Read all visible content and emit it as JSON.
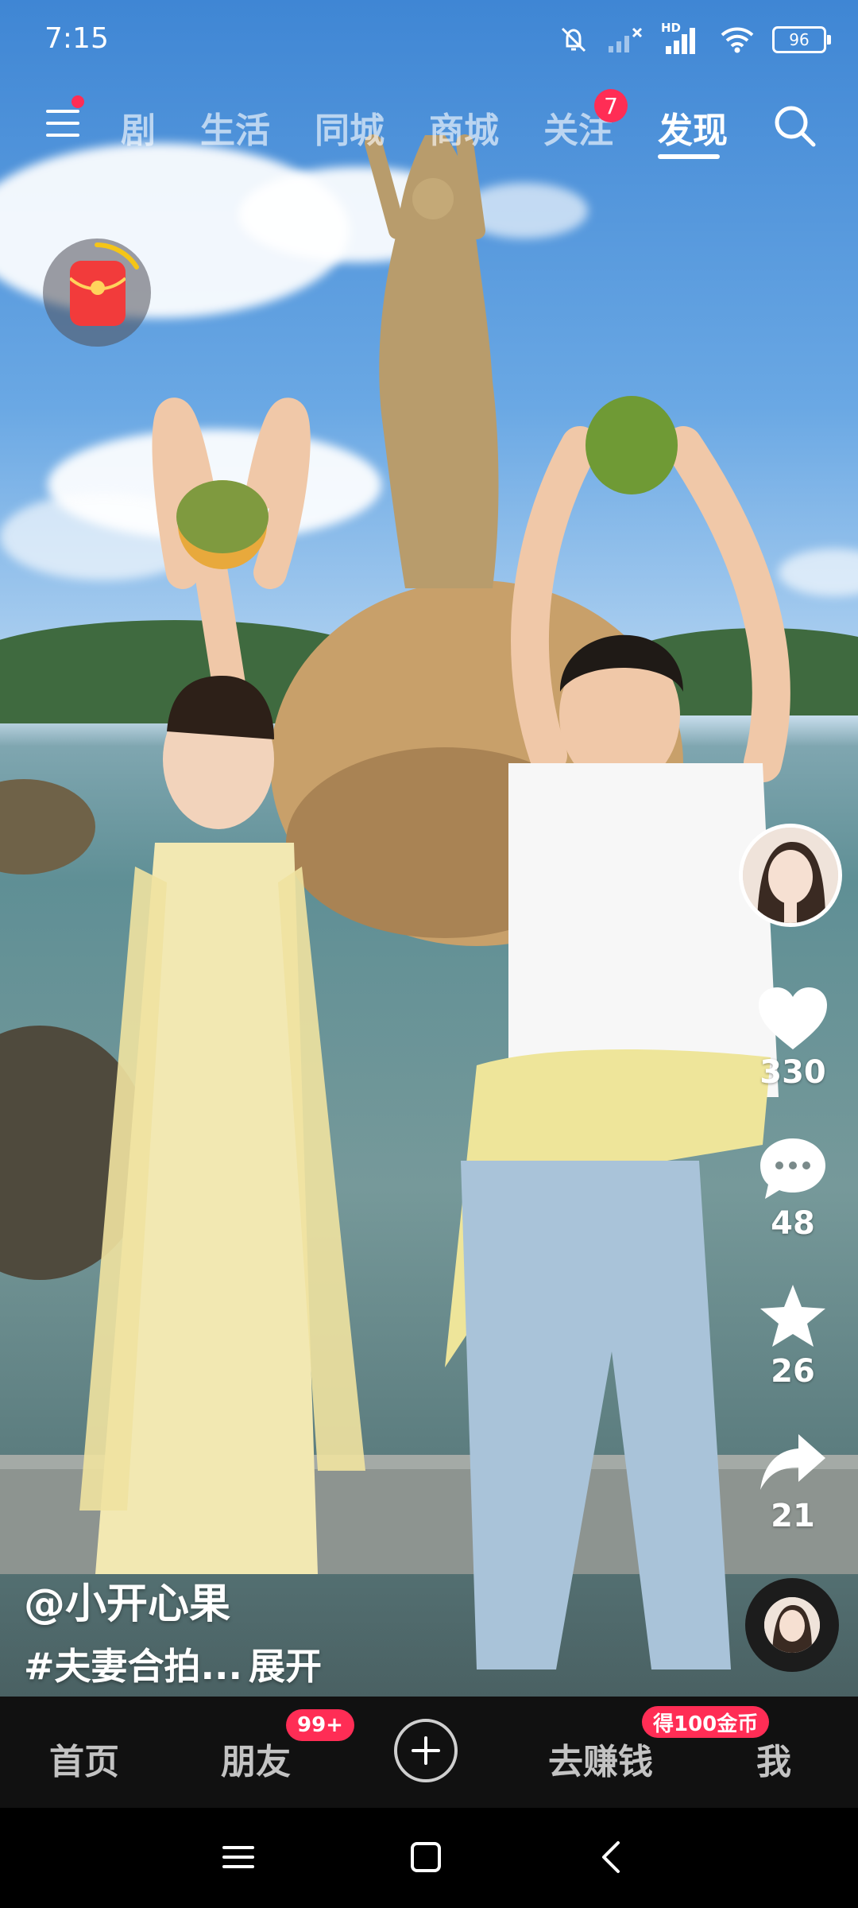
{
  "status_bar": {
    "time": "7:15",
    "battery": "96",
    "network_label": "HD",
    "icons": [
      "mute-bell-icon",
      "no-signal-icon",
      "signal-icon",
      "wifi-icon",
      "battery-icon"
    ]
  },
  "top_nav": {
    "menu_has_dot": true,
    "tabs": [
      {
        "label": "剧",
        "active": false
      },
      {
        "label": "生活",
        "active": false
      },
      {
        "label": "同城",
        "active": false
      },
      {
        "label": "商城",
        "active": false
      },
      {
        "label": "关注",
        "active": false
      },
      {
        "label": "发现",
        "active": true
      }
    ],
    "follow_badge": "7"
  },
  "side_actions": {
    "likes": "330",
    "comments": "48",
    "favorites": "26",
    "shares": "21"
  },
  "video": {
    "author": "@小开心果",
    "caption": "#夫妻合拍...",
    "expand_label": "展开"
  },
  "bottom_nav": {
    "home": "首页",
    "friends": "朋友",
    "friends_badge": "99+",
    "earn": "去赚钱",
    "earn_badge": "得100金币",
    "me": "我"
  },
  "colors": {
    "accent": "#ff2d55",
    "bar_bg": "#111111"
  }
}
